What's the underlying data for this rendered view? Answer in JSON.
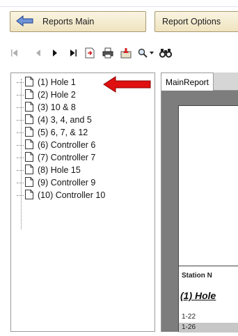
{
  "toolbar": {
    "reports_main_label": "Reports Main",
    "report_options_label": "Report Options"
  },
  "navbar": {
    "icons": [
      "first-page-icon",
      "previous-page-icon",
      "next-page-icon",
      "last-page-icon",
      "goto-page-icon",
      "print-icon",
      "export-icon",
      "zoom-icon",
      "zoom-dropdown-icon",
      "find-icon"
    ]
  },
  "tree": {
    "items": [
      {
        "label": "(1) Hole 1"
      },
      {
        "label": "(2) Hole 2"
      },
      {
        "label": "(3) 10 & 8"
      },
      {
        "label": "(4) 3, 4, and 5"
      },
      {
        "label": "(5) 6, 7, & 12"
      },
      {
        "label": "(6) Controller 6"
      },
      {
        "label": "(7) Controller 7"
      },
      {
        "label": "(8) Hole 15"
      },
      {
        "label": "(9) Controller 9"
      },
      {
        "label": "(10) Controller 10"
      }
    ]
  },
  "report": {
    "tab_label": "MainReport",
    "station_header": "Station N",
    "hole_title": "(1) Hole",
    "rows": [
      "1-22",
      "1-26"
    ]
  },
  "colors": {
    "annotation_arrow": "#e01010",
    "button_bg": "#f3ebd0",
    "report_bg": "#7d7d7d"
  }
}
